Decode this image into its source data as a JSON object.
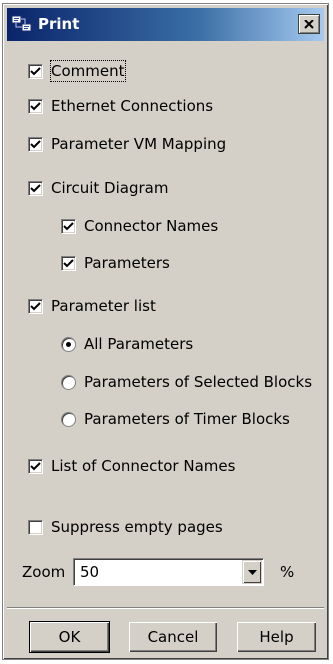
{
  "dialog": {
    "title": "Print",
    "close_label": "close"
  },
  "options": {
    "comment": {
      "label": "Comment",
      "checked": true
    },
    "ethernet_connections": {
      "label": "Ethernet Connections",
      "checked": true
    },
    "parameter_vm_mapping": {
      "label": "Parameter VM Mapping",
      "checked": true
    },
    "circuit_diagram": {
      "label": "Circuit Diagram",
      "checked": true
    },
    "connector_names": {
      "label": "Connector Names",
      "checked": true
    },
    "parameters": {
      "label": "Parameters",
      "checked": true
    },
    "parameter_list": {
      "label": "Parameter list",
      "checked": true
    },
    "all_parameters": {
      "label": "All Parameters",
      "selected": true
    },
    "selected_blocks": {
      "label": "Parameters of Selected Blocks",
      "selected": false
    },
    "timer_blocks": {
      "label": "Parameters of Timer Blocks",
      "selected": false
    },
    "list_connector_names": {
      "label": "List of Connector Names",
      "checked": true
    },
    "suppress_empty_pages": {
      "label": "Suppress empty pages",
      "checked": false
    }
  },
  "zoom": {
    "label": "Zoom",
    "value": "50",
    "unit": "%"
  },
  "buttons": {
    "ok": "OK",
    "cancel": "Cancel",
    "help": "Help"
  },
  "icons": {
    "app": "print-app-icon",
    "close": "close-icon",
    "check": "checkmark-icon",
    "dropdown": "chevron-down-icon"
  }
}
